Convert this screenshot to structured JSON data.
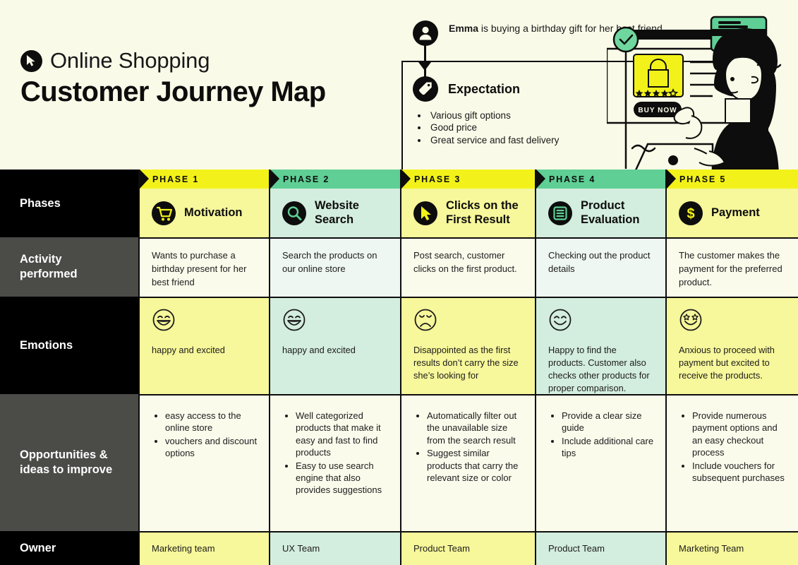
{
  "header": {
    "kicker": "Online Shopping",
    "kicker_icon": "cursor-icon",
    "title": "Customer Journey Map"
  },
  "persona": {
    "icon": "person-icon",
    "name": "Emma",
    "sentence_rest": " is buying a birthday gift for her best friend."
  },
  "expectation": {
    "icon": "tag-icon",
    "title": "Expectation",
    "items": [
      "Various gift options",
      "Good price",
      "Great service and fast delivery"
    ]
  },
  "illustration": {
    "buy_now_label": "BUY NOW",
    "rating_filled": 4,
    "rating_total": 5,
    "check_icon": "check-circle-icon",
    "card_icon": "credit-card-icon",
    "bag_icon": "shopping-bag-icon"
  },
  "colors": {
    "canvas": "#FAFAE8",
    "accent_yellow": "#F2F21A",
    "accent_green": "#5FCF95",
    "cell_yellow": "#F7F79B",
    "cell_green": "#D3EDDE",
    "cell_cream": "#FBFBEC",
    "cell_mint": "#EFF7F2",
    "row_black": "#000000",
    "row_gray": "#4B4B48",
    "ink": "#0D0D0D"
  },
  "rows": [
    {
      "label": "Phases",
      "tone": "dark"
    },
    {
      "label": "Activity\nperformed",
      "tone": "gray"
    },
    {
      "label": "Emotions",
      "tone": "dark"
    },
    {
      "label": "Opportunities &\nideas to improve",
      "tone": "gray"
    },
    {
      "label": "Owner",
      "tone": "dark"
    }
  ],
  "phases": [
    {
      "number": "PHASE 1",
      "name": "Motivation",
      "icon": "shopping-cart-icon",
      "tone": "yellow",
      "activity": "Wants to purchase a birthday present for her best friend",
      "emotion_face": "grin-face-icon",
      "emotion_text": "happy and excited",
      "opportunities": [
        "easy access to the online store",
        "vouchers and discount options"
      ],
      "owner": "Marketing team"
    },
    {
      "number": "PHASE 2",
      "name": "Website Search",
      "icon": "magnifier-icon",
      "tone": "green",
      "activity": "Search the products on our online store",
      "emotion_face": "grin-face-icon",
      "emotion_text": "happy and excited",
      "opportunities": [
        "Well categorized products that make it easy and fast to find products",
        "Easy to use search engine that also provides suggestions"
      ],
      "owner": "UX Team"
    },
    {
      "number": "PHASE 3",
      "name": "Clicks on the First Result",
      "icon": "cursor-icon",
      "tone": "yellow",
      "activity": "Post search, customer clicks on the first product.",
      "emotion_face": "sad-face-icon",
      "emotion_text": "Disappointed as the first results don’t carry the size she’s looking for",
      "opportunities": [
        "Automatically filter out the unavailable size from the search result",
        "Suggest similar products that carry the relevant size or color"
      ],
      "owner": "Product Team"
    },
    {
      "number": "PHASE 4",
      "name": "Product Evaluation",
      "icon": "list-icon",
      "tone": "green",
      "activity": "Checking out the product details",
      "emotion_face": "smile-face-icon",
      "emotion_text": "Happy to find the products. Customer also checks other products for proper comparison.",
      "opportunities": [
        "Provide a clear size guide",
        "Include additional care tips"
      ],
      "owner": "Product Team"
    },
    {
      "number": "PHASE 5",
      "name": "Payment",
      "icon": "dollar-icon",
      "tone": "yellow",
      "activity": "The customer makes the payment for the preferred product.",
      "emotion_face": "star-eyes-face-icon",
      "emotion_text": "Anxious to proceed with payment but excited to receive the products.",
      "opportunities": [
        "Provide numerous payment options and an easy checkout process",
        "Include vouchers for subsequent purchases"
      ],
      "owner": "Marketing Team"
    }
  ]
}
